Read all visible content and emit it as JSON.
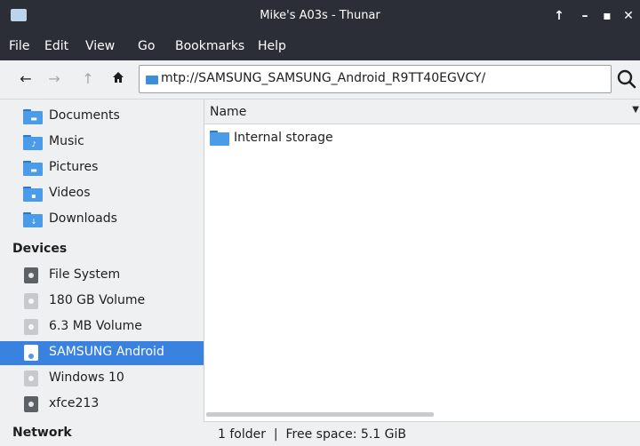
{
  "window": {
    "title": "Mike's A03s - Thunar"
  },
  "menu": [
    "File",
    "Edit",
    "View",
    "Go",
    "Bookmarks",
    "Help"
  ],
  "toolbar": {
    "location": "mtp://SAMSUNG_SAMSUNG_Android_R9TT40EGVCY/"
  },
  "sidebar": {
    "places": [
      {
        "label": "Documents",
        "icon": "documents-folder-icon"
      },
      {
        "label": "Music",
        "icon": "music-folder-icon"
      },
      {
        "label": "Pictures",
        "icon": "pictures-folder-icon"
      },
      {
        "label": "Videos",
        "icon": "videos-folder-icon"
      },
      {
        "label": "Downloads",
        "icon": "downloads-folder-icon"
      }
    ],
    "devices_heading": "Devices",
    "devices": [
      {
        "label": "File System",
        "icon": "drive-icon"
      },
      {
        "label": "180 GB Volume",
        "icon": "drive-icon"
      },
      {
        "label": "6.3 MB Volume",
        "icon": "drive-icon"
      },
      {
        "label": "SAMSUNG Android",
        "icon": "phone-icon",
        "selected": true
      },
      {
        "label": "Windows 10",
        "icon": "drive-icon"
      },
      {
        "label": "xfce213",
        "icon": "drive-icon"
      }
    ],
    "network_heading": "Network"
  },
  "main": {
    "column_name": "Name",
    "items": [
      {
        "label": "Internal storage",
        "icon": "folder-icon"
      }
    ]
  },
  "status": {
    "text": "1 folder  |  Free space: 5.1 GiB"
  },
  "colors": {
    "titlebar": "#2b2e37",
    "selection": "#3a82e0",
    "folder": "#4a9be8"
  }
}
